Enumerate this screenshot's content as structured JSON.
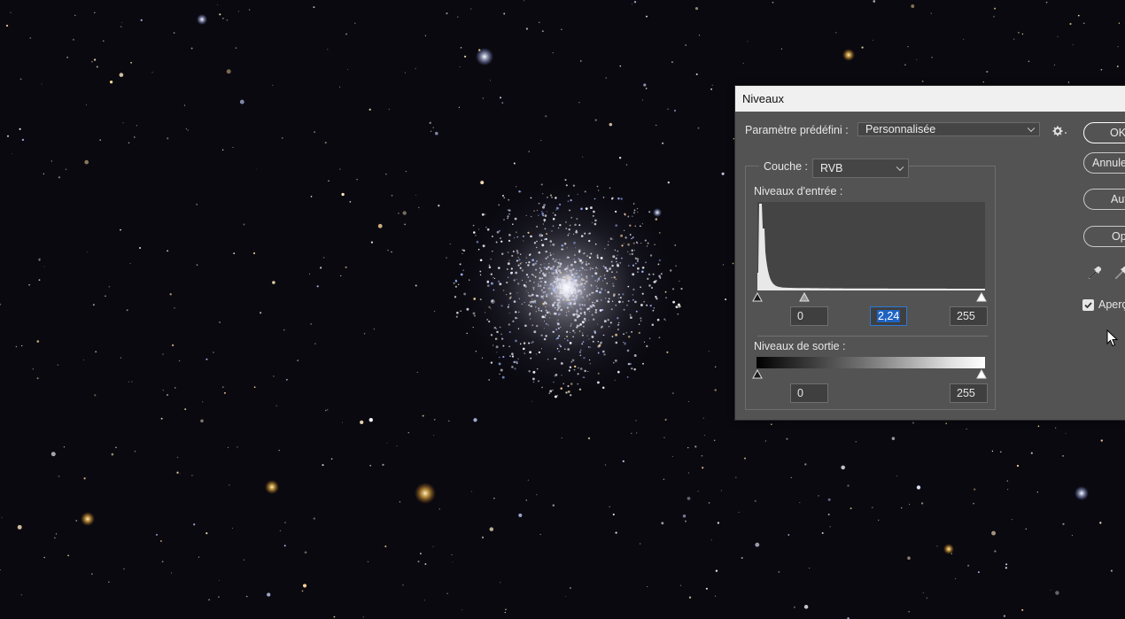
{
  "background": {
    "subject": "globular-star-cluster-photo",
    "color": "#0a0910"
  },
  "dialog": {
    "title": "Niveaux",
    "preset": {
      "label": "Paramètre prédéfini :",
      "value": "Personnalisée"
    },
    "channel": {
      "label": "Couche :",
      "value": "RVB"
    },
    "input_levels": {
      "label": "Niveaux d'entrée :",
      "shadow": "0",
      "gamma": "2,24",
      "highlight": "255",
      "shadow_level": 0,
      "gamma_level": 0.21,
      "highlight_level": 1
    },
    "output_levels": {
      "label": "Niveaux de sortie :",
      "shadow": "0",
      "highlight": "255",
      "shadow_level": 0,
      "highlight_level": 1
    },
    "buttons": {
      "ok": "OK",
      "cancel": "Annuler",
      "auto": "Auto",
      "options": "Options..."
    },
    "preview": {
      "label": "Aperçu",
      "checked": true
    },
    "histogram_color": "#e8e8e8"
  }
}
